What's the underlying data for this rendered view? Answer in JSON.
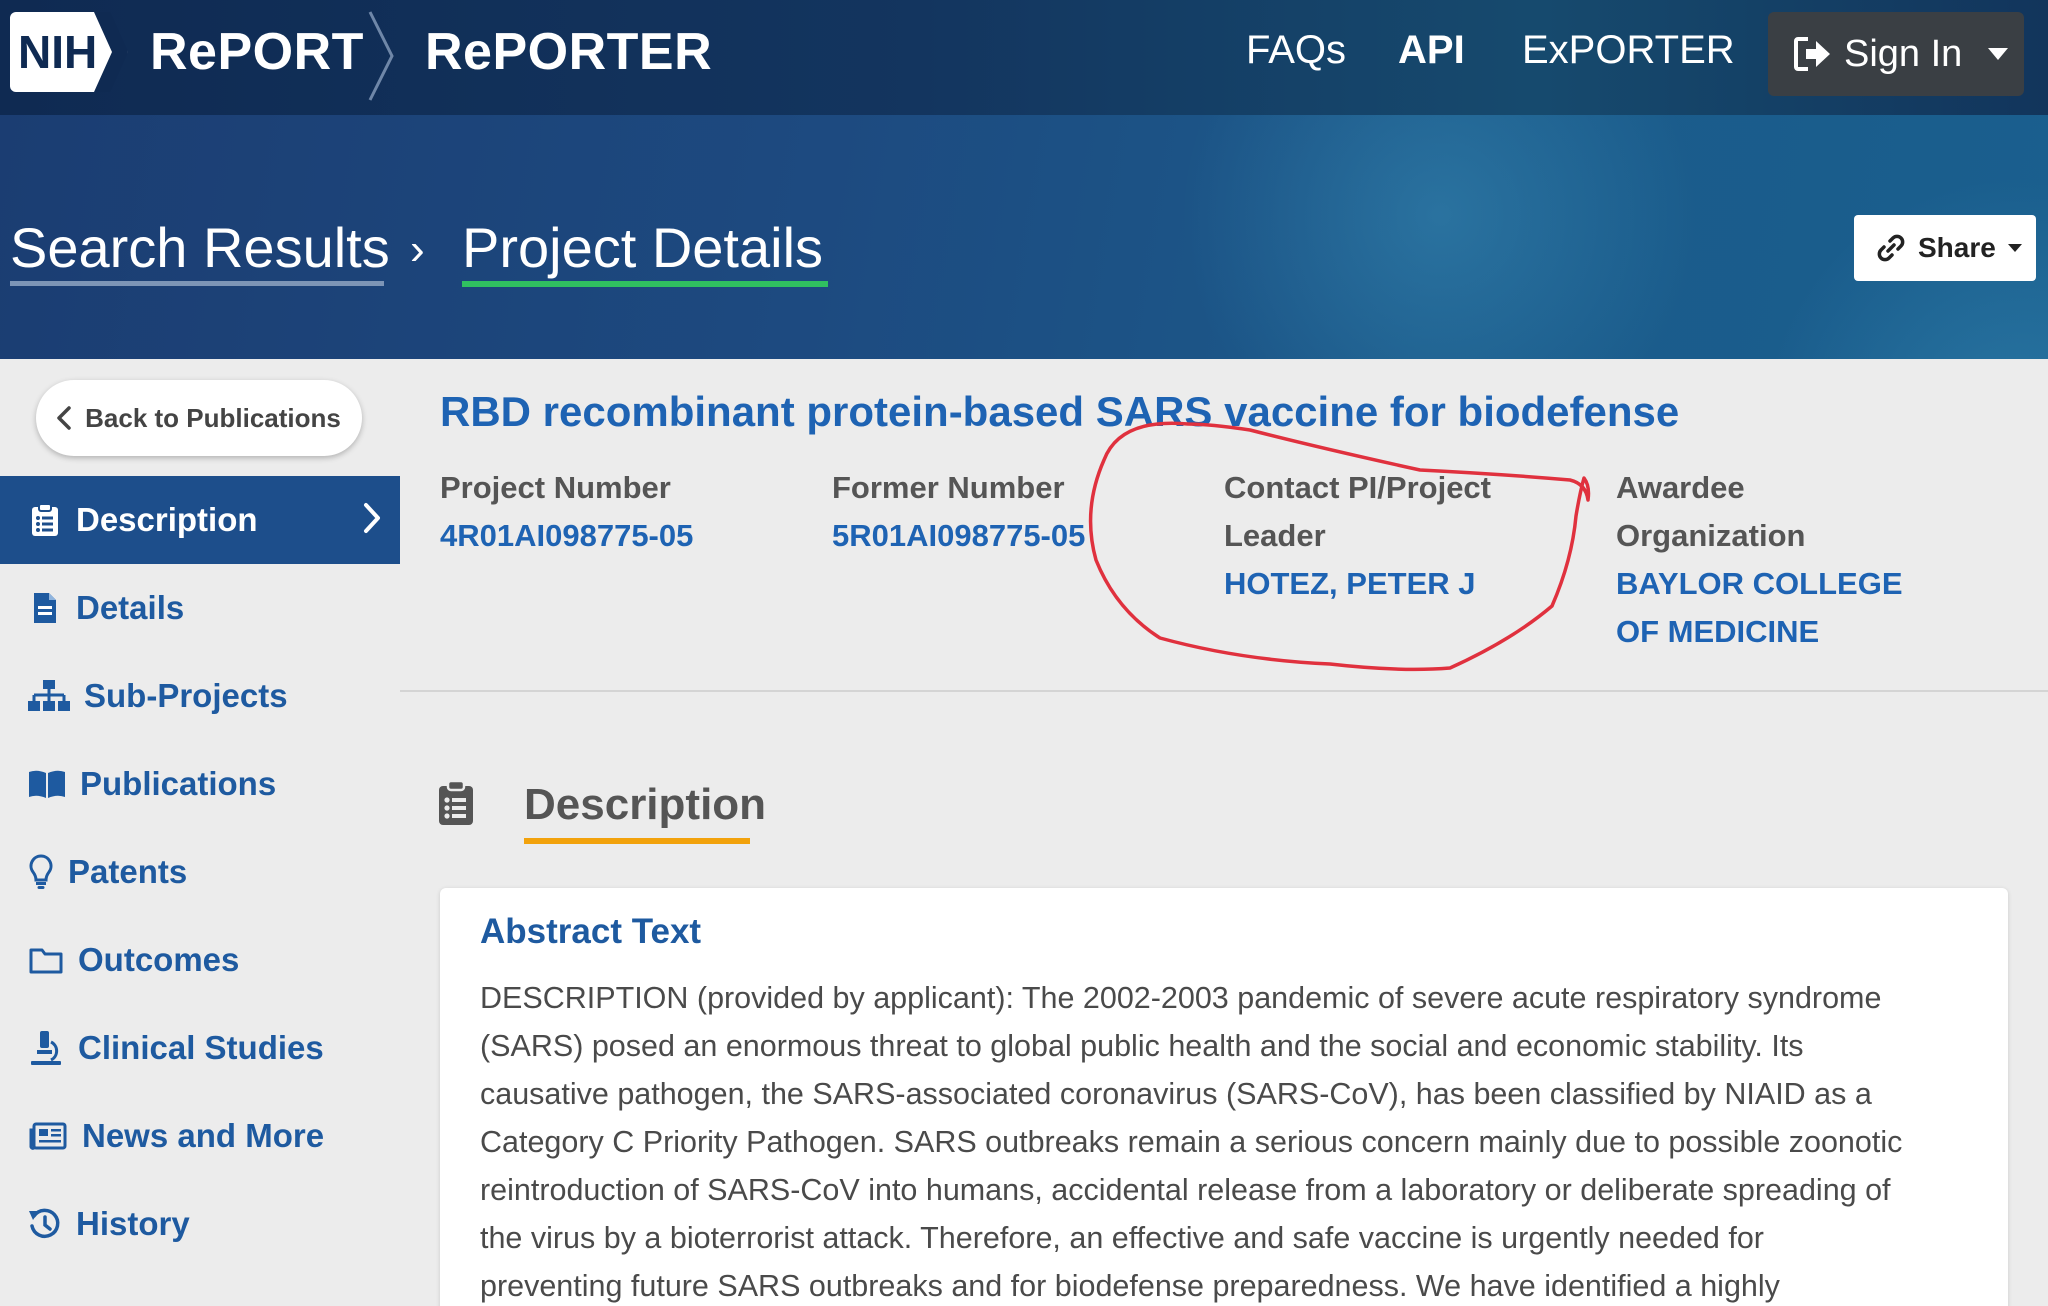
{
  "header": {
    "logo_text": "NIH",
    "brand_report": "RePORT",
    "brand_reporter": "RePORTER",
    "nav": {
      "faqs": "FAQs",
      "api": "API",
      "exporter": "ExPORTER"
    },
    "sign_in": "Sign In"
  },
  "breadcrumb": {
    "search_results": "Search Results",
    "separator": "›",
    "project_details": "Project Details"
  },
  "share_label": "Share",
  "sidebar": {
    "back_label": "Back to Publications",
    "items": [
      {
        "label": "Description",
        "icon": "clipboard-list-icon"
      },
      {
        "label": "Details",
        "icon": "document-icon"
      },
      {
        "label": "Sub-Projects",
        "icon": "sitemap-icon"
      },
      {
        "label": "Publications",
        "icon": "book-open-icon"
      },
      {
        "label": "Patents",
        "icon": "lightbulb-icon"
      },
      {
        "label": "Outcomes",
        "icon": "folder-icon"
      },
      {
        "label": "Clinical Studies",
        "icon": "microscope-icon"
      },
      {
        "label": "News and More",
        "icon": "newspaper-icon"
      },
      {
        "label": "History",
        "icon": "history-icon"
      }
    ]
  },
  "project": {
    "title": "RBD recombinant protein-based SARS vaccine for biodefense",
    "project_number_label": "Project Number",
    "project_number": "4R01AI098775-05",
    "former_number_label": "Former Number",
    "former_number": "5R01AI098775-05",
    "contact_pi_label_1": "Contact PI/Project",
    "contact_pi_label_2": "Leader",
    "contact_pi": "HOTEZ, PETER J",
    "awardee_label_1": "Awardee",
    "awardee_label_2": "Organization",
    "awardee_1": "BAYLOR COLLEGE",
    "awardee_2": "OF MEDICINE"
  },
  "description": {
    "heading": "Description",
    "abstract_title": "Abstract Text",
    "abstract_lines": [
      "DESCRIPTION (provided by applicant): The 2002-2003 pandemic of severe acute respiratory syndrome",
      "(SARS) posed an enormous threat to global public health and the social and economic stability. Its",
      "causative pathogen, the SARS-associated coronavirus (SARS-CoV), has been classified by NIAID as a",
      "Category C Priority Pathogen. SARS outbreaks remain a serious concern mainly due to possible zoonotic",
      "reintroduction of SARS-CoV into humans, accidental release from a laboratory or deliberate spreading of",
      "the virus by a bioterrorist attack. Therefore, an effective and safe vaccine is urgently needed for",
      "preventing future SARS outbreaks and for biodefense preparedness. We have identified a highly"
    ]
  },
  "colors": {
    "nav_bg": "#13355f",
    "link_blue": "#1e63b3",
    "active_sidebar": "#1d4e8b",
    "tab_underline": "#f2a20c",
    "breadcrumb_underline": "#30c060",
    "annotation_red": "#e0313e"
  }
}
